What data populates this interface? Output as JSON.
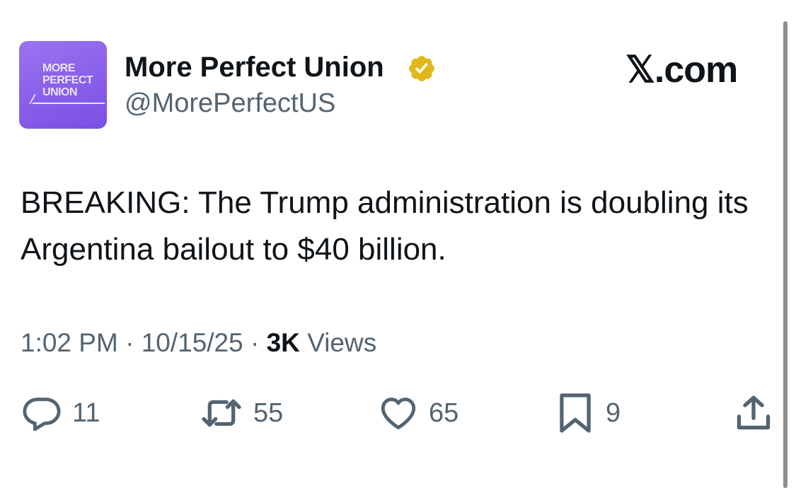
{
  "author": {
    "display_name": "More Perfect Union",
    "handle": "@MorePerfectUS",
    "avatar_lines": [
      "MORE",
      "PERFECT",
      "UNION"
    ],
    "verified": true,
    "verified_color": "#e2b719",
    "avatar_color": "#8a63ec"
  },
  "brand": "𝕏.com",
  "tweet": {
    "text": "BREAKING: The Trump administration is doubling its Argentina bailout to $40 billion."
  },
  "meta": {
    "time": "1:02 PM",
    "date": "10/15/25",
    "views_count": "3K",
    "views_label": "Views"
  },
  "actions": {
    "replies": "11",
    "reposts": "55",
    "likes": "65",
    "bookmarks": "9",
    "icons": [
      "reply-icon",
      "repost-icon",
      "like-icon",
      "bookmark-icon",
      "share-icon"
    ]
  },
  "colors": {
    "text": "#0f1419",
    "secondary": "#536471"
  }
}
